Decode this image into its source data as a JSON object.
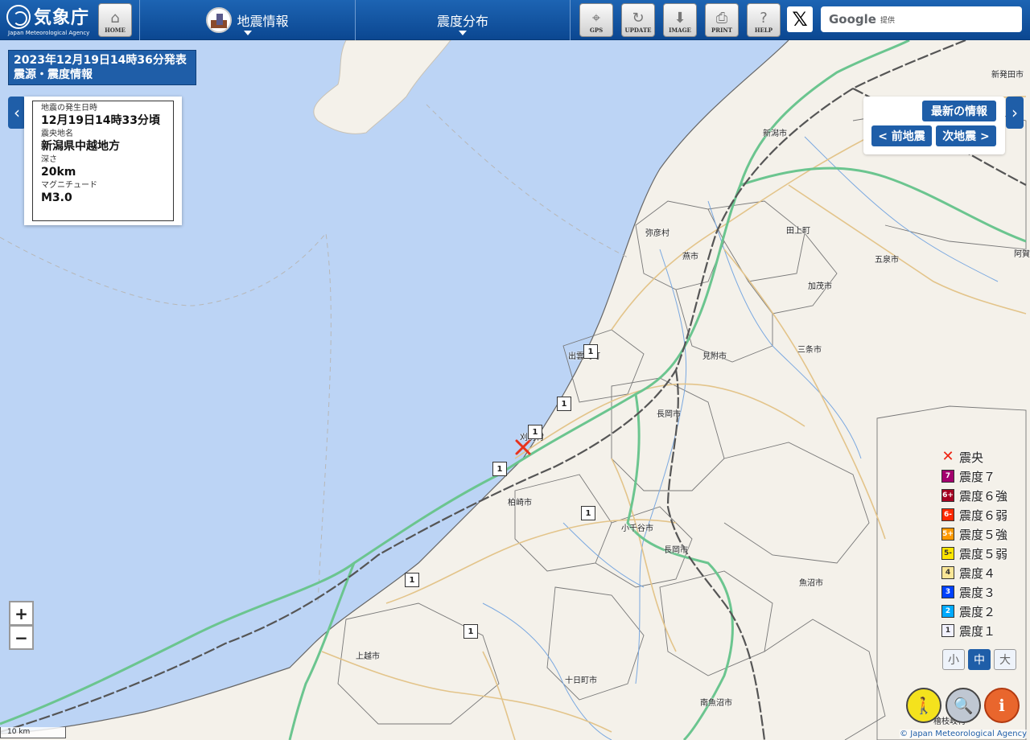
{
  "header": {
    "logo": {
      "name": "気象庁",
      "en": "Japan Meteorological Agency"
    },
    "home_label": "HOME",
    "menu1": "地震情報",
    "menu2": "震度分布",
    "tools": {
      "gps": "GPS",
      "update": "UPDATE",
      "image": "IMAGE",
      "print": "PRINT",
      "help": "HELP"
    },
    "x_label": "𝕏",
    "google": {
      "brand": "Google",
      "provided": "提供"
    }
  },
  "announcement": {
    "line1": "2023年12月19日14時36分発表",
    "line2": "震源・震度情報"
  },
  "quake": {
    "time_label": "地震の発生日時",
    "time": "12月19日14時33分頃",
    "region_label": "震央地名",
    "region": "新潟県中越地方",
    "depth_label": "深さ",
    "depth": "20km",
    "mag_label": "マグニチュード",
    "mag": "M3.0"
  },
  "nav": {
    "latest": "最新の情報",
    "prev": "< 前地震",
    "next": "次地震 >"
  },
  "legend": {
    "epicenter": "震央",
    "levels": [
      {
        "sym": "7",
        "label": "震度７",
        "bg": "#a3006e",
        "fg": "#ffffff"
      },
      {
        "sym": "6+",
        "label": "震度６強",
        "bg": "#a50021",
        "fg": "#ffffff"
      },
      {
        "sym": "6-",
        "label": "震度６弱",
        "bg": "#ff2800",
        "fg": "#ffffff"
      },
      {
        "sym": "5+",
        "label": "震度５強",
        "bg": "#ff9900",
        "fg": "#ffffff"
      },
      {
        "sym": "5-",
        "label": "震度５弱",
        "bg": "#ffe600",
        "fg": "#333333"
      },
      {
        "sym": "4",
        "label": "震度４",
        "bg": "#fae696",
        "fg": "#333333"
      },
      {
        "sym": "3",
        "label": "震度３",
        "bg": "#0041ff",
        "fg": "#ffffff"
      },
      {
        "sym": "2",
        "label": "震度２",
        "bg": "#00aaff",
        "fg": "#ffffff"
      },
      {
        "sym": "1",
        "label": "震度１",
        "bg": "#f2f2ff",
        "fg": "#333333"
      }
    ]
  },
  "size_buttons": {
    "small": "小",
    "medium": "中",
    "large": "大",
    "selected": "medium"
  },
  "zoom": {
    "in": "+",
    "out": "−"
  },
  "scale": "10 km",
  "copyright": "© Japan Meteorological Agency",
  "cities": [
    {
      "name": "新発田市"
    },
    {
      "name": "新潟市"
    },
    {
      "name": "弥彦村"
    },
    {
      "name": "燕市"
    },
    {
      "name": "田上町"
    },
    {
      "name": "五泉市"
    },
    {
      "name": "阿賀"
    },
    {
      "name": "加茂市"
    },
    {
      "name": "出雲崎町"
    },
    {
      "name": "見附市"
    },
    {
      "name": "三条市"
    },
    {
      "name": "長岡市"
    },
    {
      "name": "刈羽村"
    },
    {
      "name": "柏崎市"
    },
    {
      "name": "小千谷市"
    },
    {
      "name": "長岡市"
    },
    {
      "name": "魚沼市"
    },
    {
      "name": "上越市"
    },
    {
      "name": "十日町市"
    },
    {
      "name": "南魚沼市"
    },
    {
      "name": "檜枝岐村"
    }
  ],
  "intensity_marks": [
    "1",
    "1",
    "1",
    "1",
    "1",
    "1",
    "1"
  ]
}
